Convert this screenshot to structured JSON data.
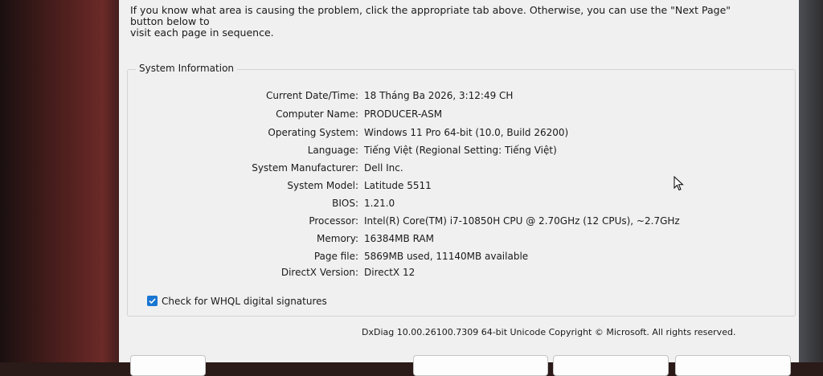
{
  "intro": {
    "line1": "If you know what area is causing the problem, click the appropriate tab above.  Otherwise, you can use the \"Next Page\" button below to",
    "line2": "visit each page in sequence."
  },
  "group": {
    "title": "System Information"
  },
  "sysinfo": [
    {
      "label": "Current Date/Time:",
      "value": "18 Tháng Ba 2026, 3:12:49 CH"
    },
    {
      "label": "Computer Name:",
      "value": "PRODUCER-ASM"
    },
    {
      "label": "Operating System:",
      "value": "Windows 11 Pro 64-bit (10.0, Build 26200)"
    },
    {
      "label": "Language:",
      "value": "Tiếng Việt (Regional Setting: Tiếng Việt)"
    },
    {
      "label": "System Manufacturer:",
      "value": "Dell Inc."
    },
    {
      "label": "System Model:",
      "value": "Latitude 5511"
    },
    {
      "label": "BIOS:",
      "value": "1.21.0"
    },
    {
      "label": "Processor:",
      "value": "Intel(R) Core(TM) i7-10850H CPU @ 2.70GHz (12 CPUs), ~2.7GHz"
    },
    {
      "label": "Memory:",
      "value": "16384MB RAM"
    },
    {
      "label": "Page file:",
      "value": "5869MB used, 11140MB available"
    },
    {
      "label": "DirectX Version:",
      "value": "DirectX 12"
    }
  ],
  "whql": {
    "label": "Check for WHQL digital signatures",
    "checked": true
  },
  "footer": "DxDiag 10.00.26100.7309 64-bit Unicode  Copyright © Microsoft. All rights reserved.",
  "colors": {
    "window_bg": "#f0f0f0",
    "checkbox_accent": "#1976d2"
  },
  "icons": [
    "checkmark-icon",
    "mouse-cursor-icon"
  ]
}
